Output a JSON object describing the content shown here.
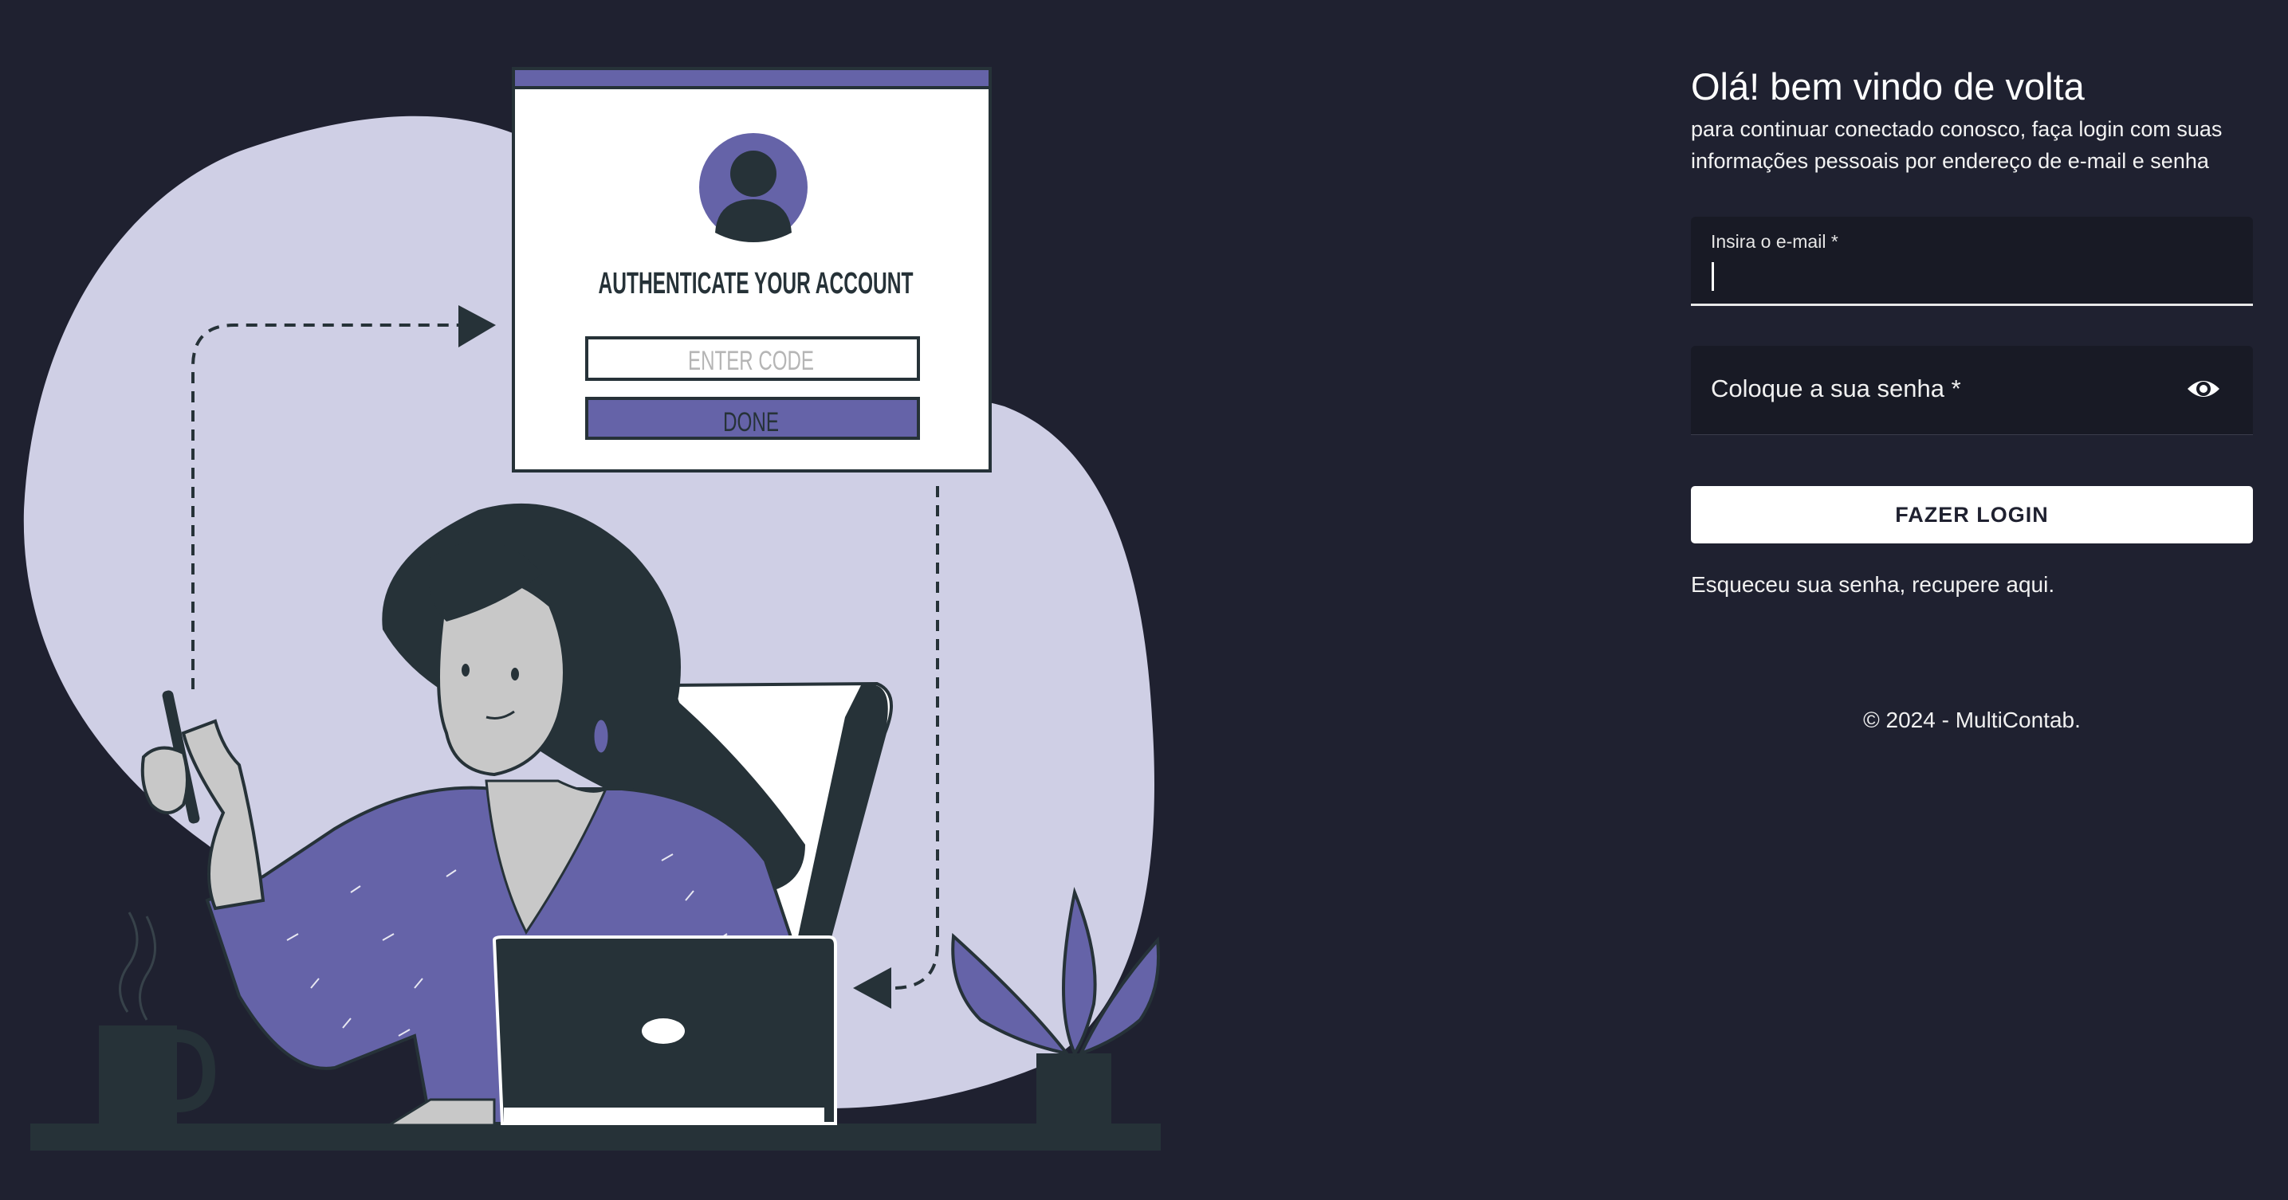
{
  "illustration": {
    "card_title": "AUTHENTICATE YOUR ACCOUNT",
    "code_placeholder": "ENTER CODE",
    "done_label": "DONE"
  },
  "login": {
    "title": "Olá! bem vindo de volta",
    "subtitle": "para continuar conectado conosco, faça login com suas informações pessoais por endereço de e-mail e senha",
    "email_label": "Insira o e-mail *",
    "email_value": "",
    "password_label": "Coloque a sua senha *",
    "password_toggle_icon": "eye-icon",
    "submit_label": "FAZER LOGIN",
    "forgot_link": "Esqueceu sua senha, recupere aqui.",
    "copyright": "© 2024 - MultiContab."
  },
  "colors": {
    "background": "#1f2130",
    "field_background": "#181a25",
    "accent_purple": "#6563a8",
    "blob_lavender": "#cfcfe5",
    "dark_slate": "#263238"
  }
}
